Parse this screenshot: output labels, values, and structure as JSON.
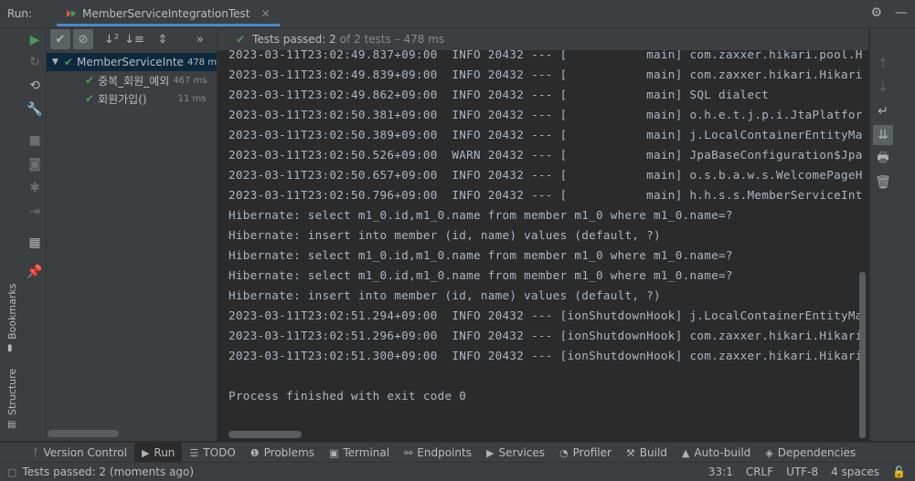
{
  "run_header": {
    "run_label": "Run:",
    "tab_title": "MemberServiceIntegrationTest"
  },
  "tree_toolbar": {
    "status_passed": "Tests passed: 2",
    "status_of": "of 2 tests – 478 ms"
  },
  "tree": {
    "root": {
      "label": "MemberServiceInte",
      "duration": "478 ms"
    },
    "children": [
      {
        "label": "중복_회원_예외",
        "duration": "467 ms"
      },
      {
        "label": "회원가입()",
        "duration": "11 ms"
      }
    ]
  },
  "console": {
    "lines": [
      "2023-03-11T23:02:49.837+09:00  INFO 20432 --- [           main] com.zaxxer.hikari.pool.H",
      "2023-03-11T23:02:49.839+09:00  INFO 20432 --- [           main] com.zaxxer.hikari.Hikari",
      "2023-03-11T23:02:49.862+09:00  INFO 20432 --- [           main] SQL dialect",
      "2023-03-11T23:02:50.381+09:00  INFO 20432 --- [           main] o.h.e.t.j.p.i.JtaPlatfor",
      "2023-03-11T23:02:50.389+09:00  INFO 20432 --- [           main] j.LocalContainerEntityMa",
      "2023-03-11T23:02:50.526+09:00  WARN 20432 --- [           main] JpaBaseConfiguration$Jpa",
      "2023-03-11T23:02:50.657+09:00  INFO 20432 --- [           main] o.s.b.a.w.s.WelcomePageH",
      "2023-03-11T23:02:50.796+09:00  INFO 20432 --- [           main] h.h.s.s.MemberServiceInt",
      "Hibernate: select m1_0.id,m1_0.name from member m1_0 where m1_0.name=?",
      "Hibernate: insert into member (id, name) values (default, ?)",
      "Hibernate: select m1_0.id,m1_0.name from member m1_0 where m1_0.name=?",
      "Hibernate: select m1_0.id,m1_0.name from member m1_0 where m1_0.name=?",
      "Hibernate: insert into member (id, name) values (default, ?)",
      "2023-03-11T23:02:51.294+09:00  INFO 20432 --- [ionShutdownHook] j.LocalContainerEntityMa",
      "2023-03-11T23:02:51.296+09:00  INFO 20432 --- [ionShutdownHook] com.zaxxer.hikari.Hikari",
      "2023-03-11T23:02:51.300+09:00  INFO 20432 --- [ionShutdownHook] com.zaxxer.hikari.Hikari",
      "",
      "Process finished with exit code 0"
    ]
  },
  "left_strip": {
    "bookmarks": "Bookmarks",
    "structure": "Structure"
  },
  "tool_windows": [
    {
      "label": "Version Control",
      "icon": "branch-icon"
    },
    {
      "label": "Run",
      "icon": "play-icon"
    },
    {
      "label": "TODO",
      "icon": "list-icon"
    },
    {
      "label": "Problems",
      "icon": "info-icon"
    },
    {
      "label": "Terminal",
      "icon": "terminal-icon"
    },
    {
      "label": "Endpoints",
      "icon": "endpoints-icon"
    },
    {
      "label": "Services",
      "icon": "services-icon"
    },
    {
      "label": "Profiler",
      "icon": "profiler-icon"
    },
    {
      "label": "Build",
      "icon": "hammer-icon"
    },
    {
      "label": "Auto-build",
      "icon": "warning-icon"
    },
    {
      "label": "Dependencies",
      "icon": "layers-icon"
    }
  ],
  "status_bar": {
    "message": "Tests passed: 2 (moments ago)",
    "position": "33:1",
    "line_sep": "CRLF",
    "encoding": "UTF-8",
    "indent": "4 spaces"
  },
  "colors": {
    "accent": "#4a88c7",
    "pass_green": "#499c54",
    "panel": "#3c3f41",
    "editor": "#2b2b2b"
  }
}
